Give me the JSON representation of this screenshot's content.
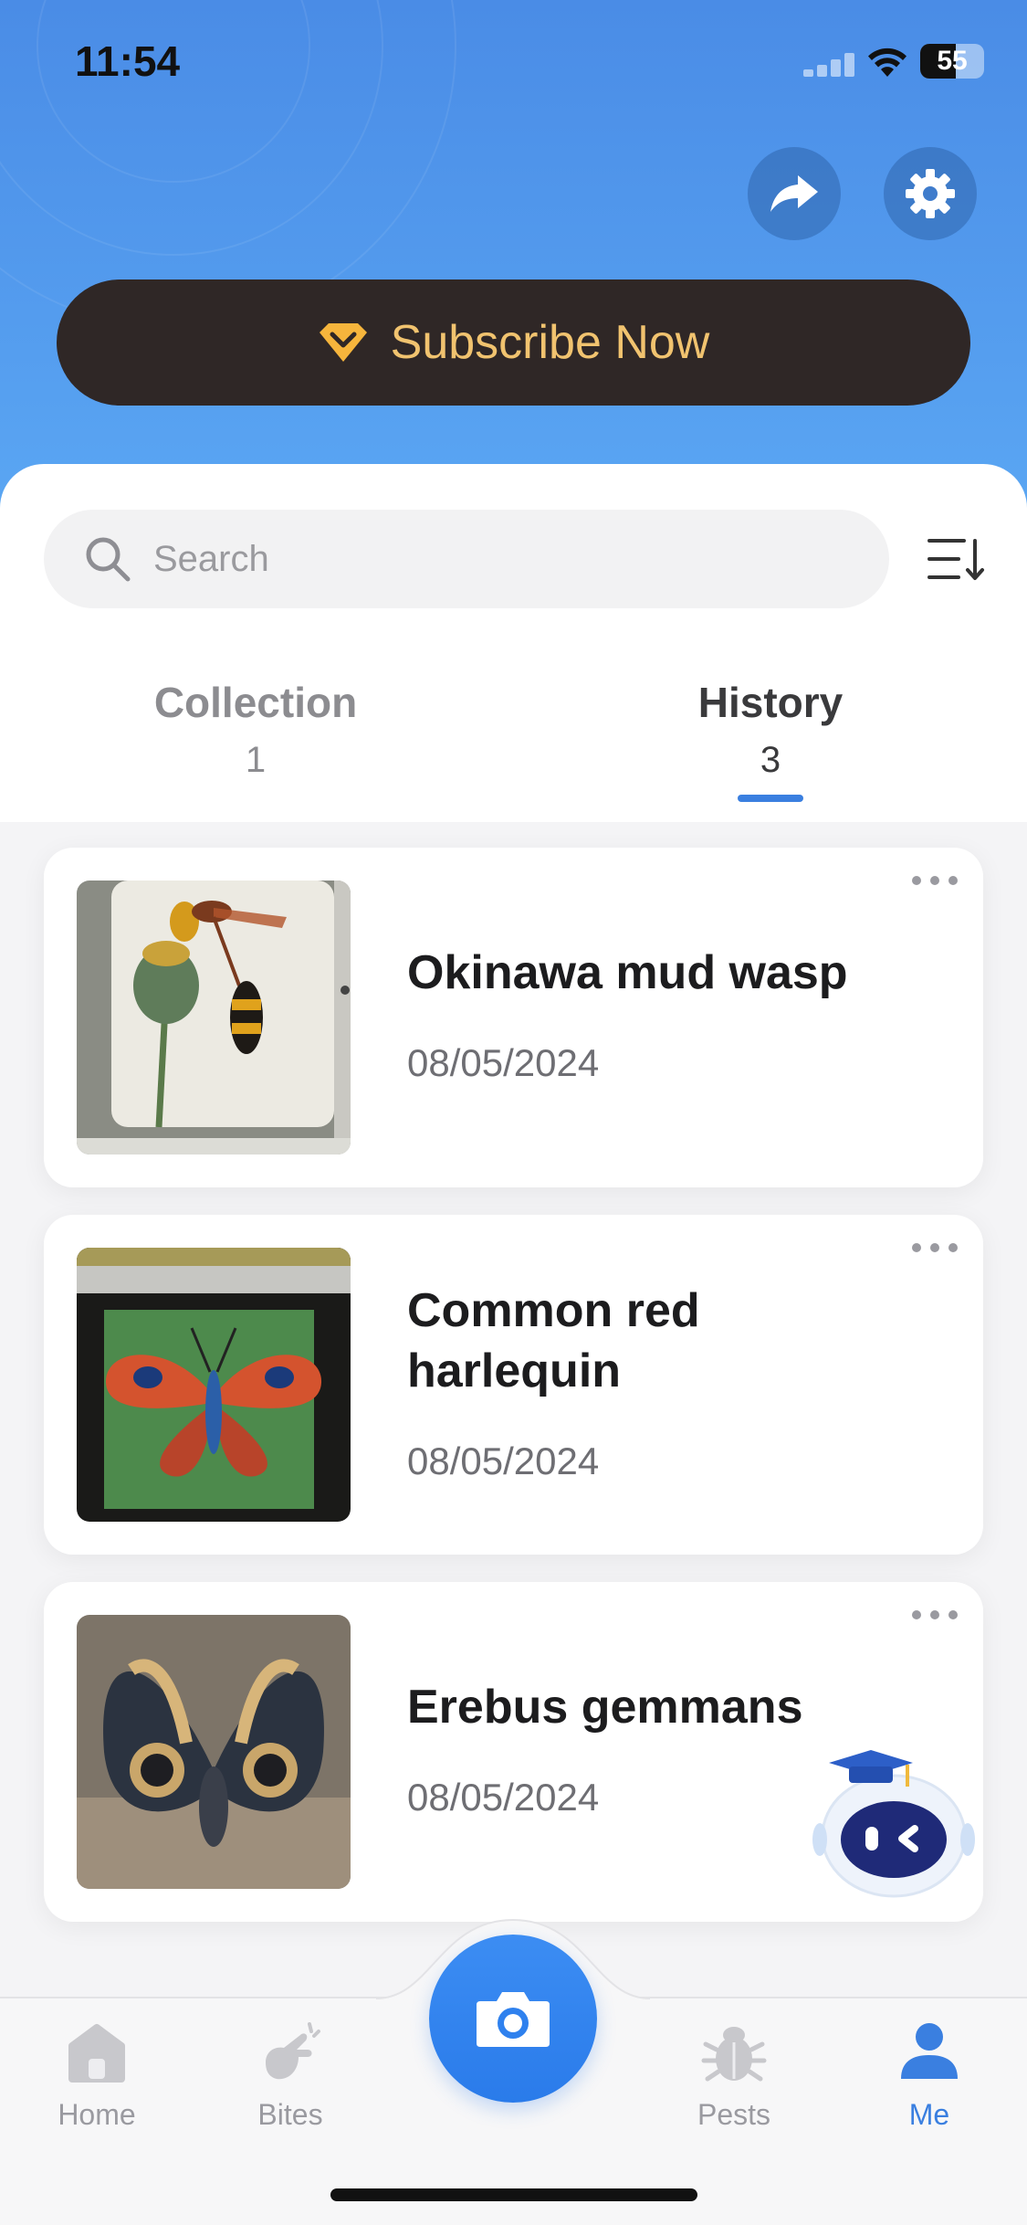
{
  "status": {
    "time": "11:54",
    "battery": "55",
    "battery_level": 0.55
  },
  "header": {
    "share_icon": "share-arrow-icon",
    "settings_icon": "gear-icon",
    "subscribe_label": "Subscribe Now",
    "subscribe_icon": "diamond-icon",
    "accent": "#f1c36f"
  },
  "search": {
    "placeholder": "Search"
  },
  "tabs": [
    {
      "label": "Collection",
      "count": "1",
      "active": false
    },
    {
      "label": "History",
      "count": "3",
      "active": true
    }
  ],
  "history": [
    {
      "title": "Okinawa mud wasp",
      "date": "08/05/2024",
      "image": "wasp-photo"
    },
    {
      "title": "Common red harlequin",
      "date": "08/05/2024",
      "image": "butterfly-photo"
    },
    {
      "title": "Erebus gemmans",
      "date": "08/05/2024",
      "image": "moth-photo"
    }
  ],
  "nav": [
    {
      "label": "Home",
      "icon": "home-icon",
      "active": false
    },
    {
      "label": "Bites",
      "icon": "bites-icon",
      "active": false
    },
    {
      "label": "Pests",
      "icon": "bug-icon",
      "active": false
    },
    {
      "label": "Me",
      "icon": "person-icon",
      "active": true
    }
  ],
  "colors": {
    "primary": "#3a7fe0",
    "header_top": "#4a8ce6",
    "header_bottom": "#5aa6f3"
  }
}
